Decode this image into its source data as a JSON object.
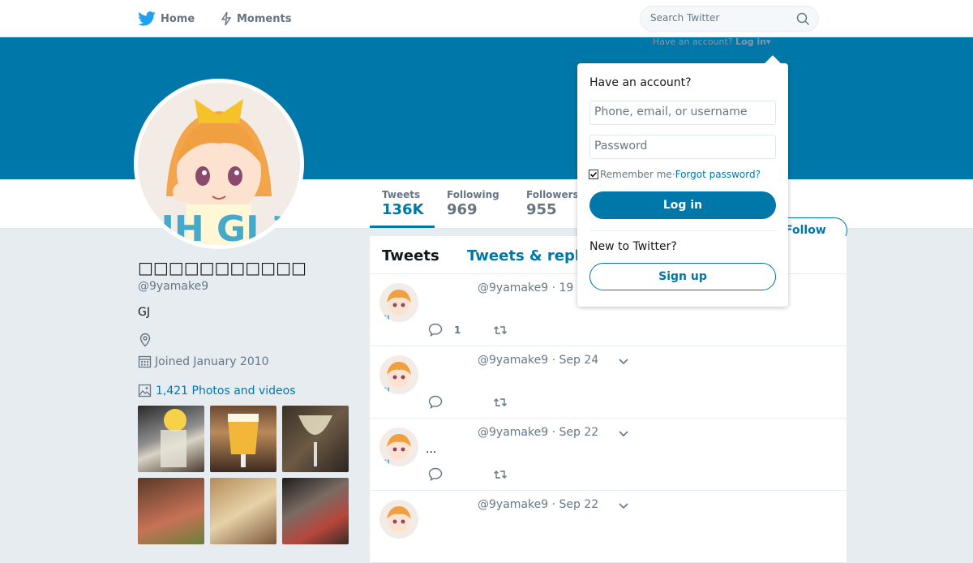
{
  "nav": {
    "home": "Home",
    "moments": "Moments",
    "search_placeholder": "Search Twitter"
  },
  "account_hint": {
    "text": "Have an account?",
    "link": "Log in"
  },
  "profile": {
    "name": "□□□□□□□□□□□",
    "handle": "@9yamake9",
    "bio": "GJ",
    "joined": "Joined January 2010",
    "photos": "1,421 Photos and videos"
  },
  "stats": [
    {
      "label": "Tweets",
      "value": "136K"
    },
    {
      "label": "Following",
      "value": "969"
    },
    {
      "label": "Followers",
      "value": "955"
    }
  ],
  "follow_label": "Follow",
  "tabs": [
    "Tweets",
    "Tweets & replies"
  ],
  "tweets": [
    {
      "handle": "@9yamake9",
      "date": "· 19",
      "text": "",
      "replies": "1"
    },
    {
      "handle": "@9yamake9",
      "date": "· Sep 24",
      "text": "",
      "replies": ""
    },
    {
      "handle": "@9yamake9",
      "date": "· Sep 22",
      "text": "...",
      "replies": ""
    },
    {
      "handle": "@9yamake9",
      "date": "· Sep 22",
      "text": "",
      "replies": ""
    }
  ],
  "login": {
    "title": "Have an account?",
    "username_placeholder": "Phone, email, or username",
    "password_placeholder": "Password",
    "remember": "Remember me",
    "separator": " · ",
    "forgot": "Forgot password?",
    "login_button": "Log in",
    "new_text": "New to Twitter?",
    "signup_button": "Sign up"
  },
  "colors": {
    "brand": "#0077a9",
    "bird": "#1da1f2",
    "background": "#e6ecf0"
  }
}
